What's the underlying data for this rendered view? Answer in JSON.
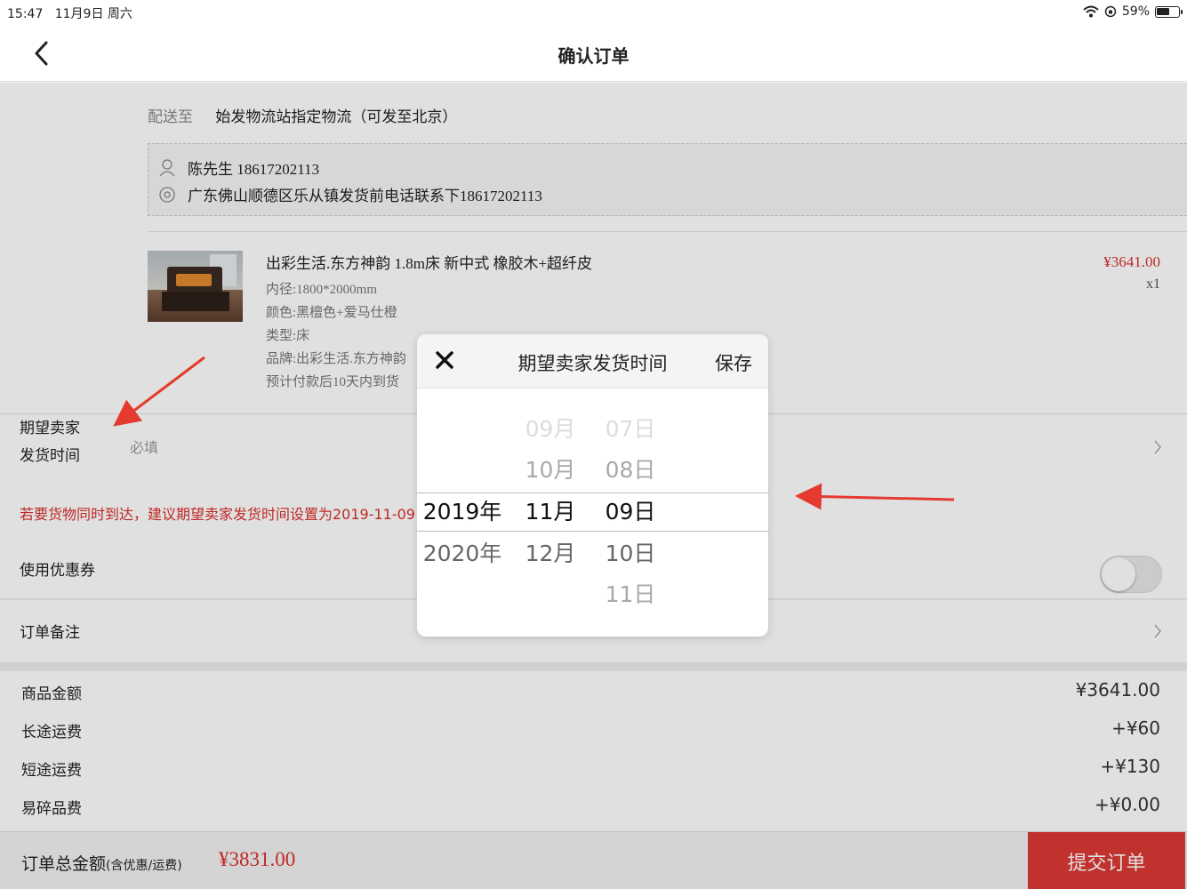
{
  "status_bar": {
    "time": "15:47",
    "date": "11月9日 周六",
    "battery": "59%",
    "battery_level": 0.59
  },
  "nav": {
    "title": "确认订单",
    "back_icon": "chevron-left-icon"
  },
  "shipping": {
    "label": "配送至",
    "value": "始发物流站指定物流（可发至北京）"
  },
  "address": {
    "name_phone": "陈先生 18617202113",
    "address": "广东佛山顺德区乐从镇发货前电话联系下18617202113"
  },
  "product": {
    "title": "出彩生活.东方神韵 1.8m床 新中式 橡胶木+超纤皮",
    "attrs": [
      "内径:1800*2000mm",
      "颜色:黑檀色+爱马仕橙",
      "类型:床",
      "品牌:出彩生活.东方神韵",
      "预计付款后10天内到货"
    ],
    "price": "¥3641.00",
    "qty": "x1"
  },
  "expect_time": {
    "label_line1": "期望卖家",
    "label_line2": "发货时间",
    "placeholder": "必填"
  },
  "tip": "若要货物同时到达，建议期望卖家发货时间设置为2019-11-09",
  "coupon": {
    "label": "使用优惠券",
    "enabled": false
  },
  "remark": {
    "label": "订单备注"
  },
  "fees": [
    {
      "label": "商品金额",
      "value": "¥3641.00"
    },
    {
      "label": "长途运费",
      "value": "+¥60"
    },
    {
      "label": "短途运费",
      "value": "+¥130"
    },
    {
      "label": "易碎品费",
      "value": "+¥0.00"
    }
  ],
  "bottom": {
    "total_label": "订单总金额",
    "total_sub": "(含优惠/运费)",
    "total_value": "¥3831.00",
    "submit_label": "提交订单"
  },
  "modal": {
    "title": "期望卖家发货时间",
    "close_icon": "close-icon",
    "save_label": "保存",
    "years": [
      "2019年",
      "2020年"
    ],
    "months": [
      "09月",
      "10月",
      "11月",
      "12月"
    ],
    "days": [
      "07日",
      "08日",
      "09日",
      "10日",
      "11日"
    ],
    "selected": {
      "year": "2019年",
      "month": "11月",
      "day": "09日"
    }
  },
  "colors": {
    "accent": "#dc3a36",
    "price_red": "#d9302c"
  }
}
